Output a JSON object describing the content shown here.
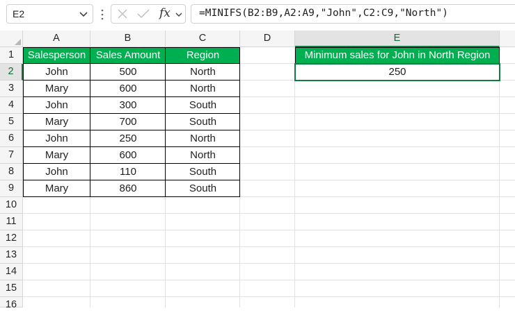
{
  "name_box": {
    "value": "E2"
  },
  "formula_bar": {
    "formula": "=MINIFS(B2:B9,A2:A9,\"John\",C2:C9,\"North\")",
    "fx_label": "fx"
  },
  "columns": [
    "A",
    "B",
    "C",
    "D",
    "E"
  ],
  "rows": [
    "1",
    "2",
    "3",
    "4",
    "5",
    "6",
    "7",
    "8",
    "9",
    "10",
    "11",
    "12",
    "13",
    "14",
    "15",
    "16"
  ],
  "table": {
    "headers": [
      "Salesperson",
      "Sales Amount",
      "Region"
    ],
    "rows": [
      [
        "John",
        "500",
        "North"
      ],
      [
        "Mary",
        "600",
        "North"
      ],
      [
        "John",
        "300",
        "South"
      ],
      [
        "Mary",
        "700",
        "South"
      ],
      [
        "John",
        "250",
        "North"
      ],
      [
        "Mary",
        "600",
        "North"
      ],
      [
        "John",
        "110",
        "South"
      ],
      [
        "Mary",
        "860",
        "South"
      ]
    ]
  },
  "result": {
    "header": "Minimum sales for John in North Region",
    "value": "250"
  },
  "colors": {
    "header_fill": "#00b050",
    "selection": "#107c41"
  }
}
